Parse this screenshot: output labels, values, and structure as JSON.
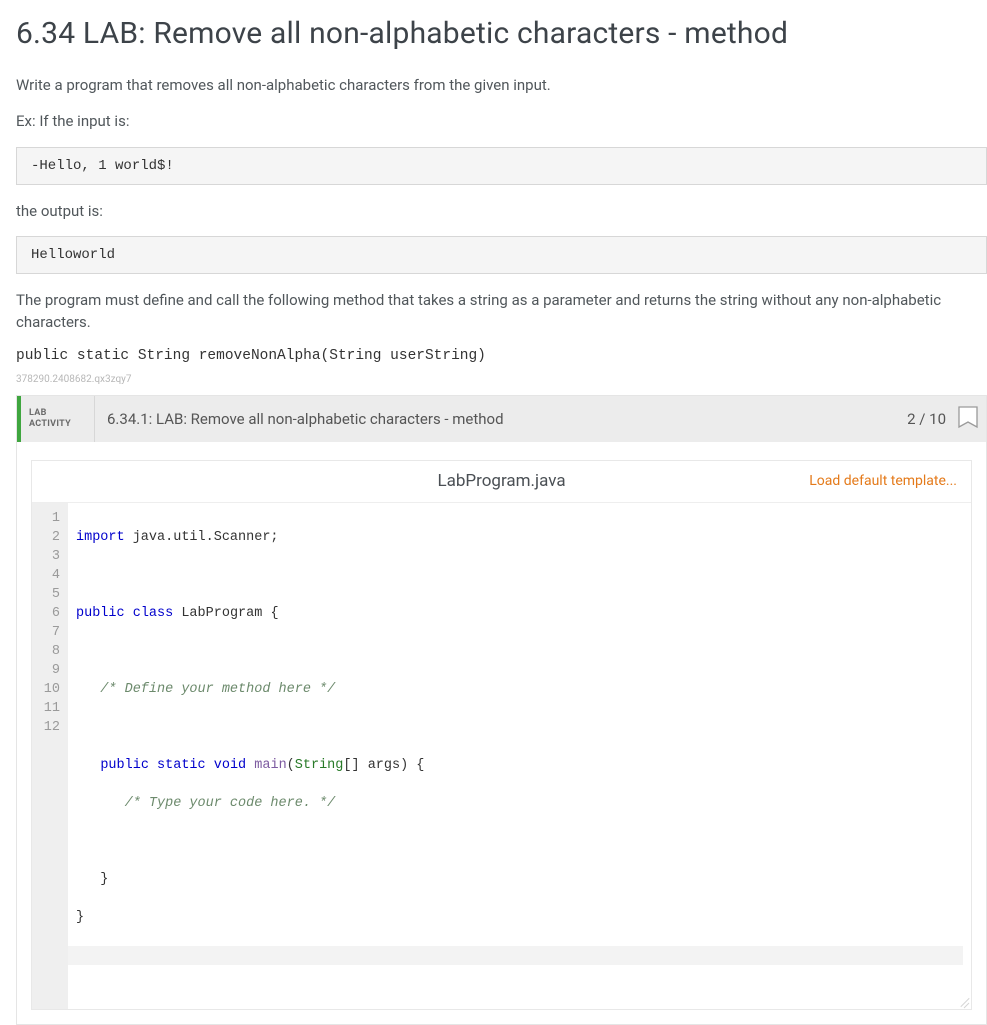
{
  "title": "6.34 LAB: Remove all non-alphabetic characters - method",
  "intro": "Write a program that removes all non-alphabetic characters from the given input.",
  "ex_label": "Ex: If the input is:",
  "ex_input": "-Hello, 1 world$!",
  "output_label": "the output is:",
  "ex_output": "Helloworld",
  "desc": "The program must define and call the following method that takes a string as a parameter and returns the string without any non-alphabetic characters.",
  "signature": "public static String removeNonAlpha(String userString)",
  "tiny_id": "378290.2408682.qx3zqy7",
  "activity": {
    "label_line1": "LAB",
    "label_line2": "ACTIVITY",
    "title": "6.34.1: LAB: Remove all non-alphabetic characters - method",
    "score": "2 / 10"
  },
  "editor": {
    "filename": "LabProgram.java",
    "load_template": "Load default template...",
    "gutter": [
      "1",
      "2",
      "3",
      "4",
      "5",
      "6",
      "7",
      "8",
      "9",
      "10",
      "11",
      "12"
    ],
    "code": {
      "l1_a": "import",
      "l1_b": " java.util.Scanner;",
      "l3_a": "public",
      "l3_b": " ",
      "l3_c": "class",
      "l3_d": " LabProgram {",
      "l5": "   /* Define your method here */",
      "l7_a": "   ",
      "l7_b": "public",
      "l7_c": " ",
      "l7_d": "static",
      "l7_e": " ",
      "l7_f": "void",
      "l7_g": " ",
      "l7_h": "main",
      "l7_i": "(",
      "l7_j": "String",
      "l7_k": "[] args) {",
      "l8": "      /* Type your code here. */",
      "l10": "   }",
      "l11": "}"
    }
  }
}
